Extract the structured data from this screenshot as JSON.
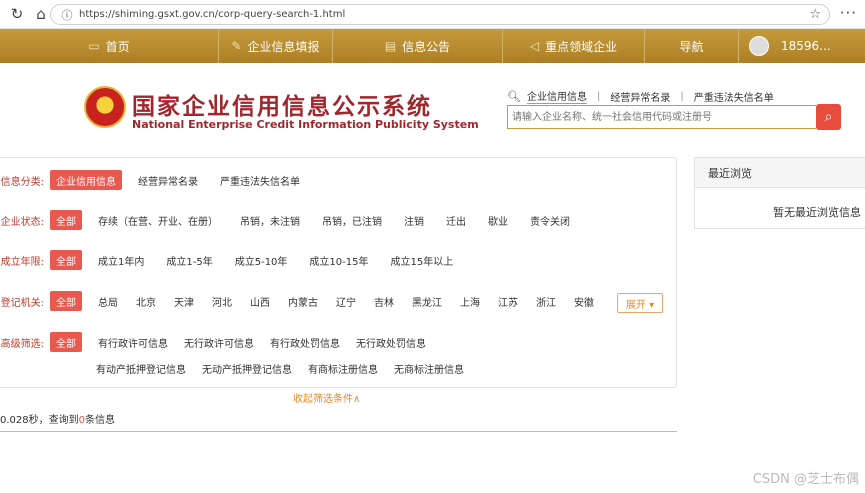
{
  "browser": {
    "url": "https://shiming.gsxt.gov.cn/corp-query-search-1.html"
  },
  "topnav": {
    "items": [
      {
        "label": "首页",
        "icon": "monitor-icon"
      },
      {
        "label": "企业信息填报",
        "icon": "edit-icon"
      },
      {
        "label": "信息公告",
        "icon": "document-icon"
      },
      {
        "label": "重点领域企业",
        "icon": "megaphone-icon"
      },
      {
        "label": "导航",
        "icon": ""
      }
    ],
    "user": "18596..."
  },
  "header": {
    "title_cn": "国家企业信用信息公示系统",
    "title_en": "National Enterprise Credit Information Publicity System",
    "search_tabs": [
      "企业信用信息",
      "经营异常名录",
      "严重违法失信名单"
    ],
    "search_placeholder": "请输入企业名称、统一社会信用代码或注册号"
  },
  "filters": {
    "category": {
      "label": "信息分类:",
      "options": [
        "企业信用信息",
        "经营异常名录",
        "严重违法失信名单"
      ]
    },
    "status": {
      "label": "企业状态:",
      "options": [
        "全部",
        "存续（在营、开业、在册）",
        "吊销，未注销",
        "吊销，已注销",
        "注销",
        "迁出",
        "歇业",
        "责令关闭"
      ]
    },
    "age": {
      "label": "成立年限:",
      "options": [
        "全部",
        "成立1年内",
        "成立1-5年",
        "成立5-10年",
        "成立10-15年",
        "成立15年以上"
      ]
    },
    "authority": {
      "label": "登记机关:",
      "options": [
        "全部",
        "总局",
        "北京",
        "天津",
        "河北",
        "山西",
        "内蒙古",
        "辽宁",
        "吉林",
        "黑龙江",
        "上海",
        "江苏",
        "浙江",
        "安徽"
      ],
      "expand": "展开 ▾"
    },
    "advanced": {
      "label": "高级筛选:",
      "row1": [
        "全部",
        "有行政许可信息",
        "无行政许可信息",
        "有行政处罚信息",
        "无行政处罚信息"
      ],
      "row2": [
        "有动产抵押登记信息",
        "无动产抵押登记信息",
        "有商标注册信息",
        "无商标注册信息"
      ]
    }
  },
  "collapse_label": "收起筛选条件∧",
  "result": {
    "prefix": "0.028秒，查询到",
    "count": "0",
    "suffix": "条信息"
  },
  "recent": {
    "title": "最近浏览",
    "empty": "暂无最近浏览信息"
  },
  "watermark": "CSDN @芝士布偶",
  "colors": {
    "nav_gold": "#b98a2e",
    "accent_red": "#e85a4f",
    "title_red": "#a0272d",
    "link_orange": "#e48a2e"
  }
}
